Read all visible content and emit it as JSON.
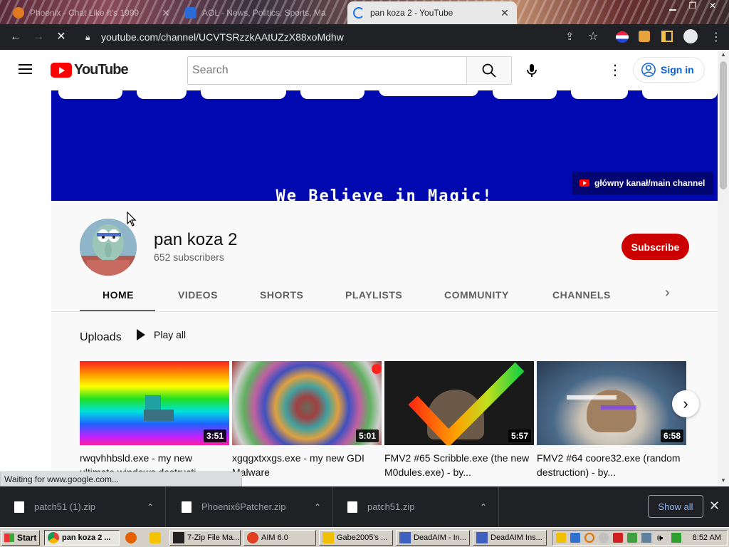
{
  "browser": {
    "tabs": [
      {
        "title": "Phoenix - Chat Like It's 1999"
      },
      {
        "title": "AOL - News, Politics, Sports, Ma"
      },
      {
        "title": "pan koza 2 - YouTube"
      }
    ],
    "url": "youtube.com/channel/UCVTSRzzkAAtUZzX88xoMdhw"
  },
  "youtube": {
    "logo_text": "YouTube",
    "search_placeholder": "Search",
    "sign_in": "Sign in",
    "banner": {
      "text": "We Believe in Magic!",
      "link": "główny kanał/main channel"
    },
    "channel": {
      "name": "pan koza 2",
      "subscribers": "652 subscribers",
      "subscribe_label": "Subscribe",
      "tabs": [
        "HOME",
        "VIDEOS",
        "SHORTS",
        "PLAYLISTS",
        "COMMUNITY",
        "CHANNELS"
      ]
    },
    "uploads": {
      "title": "Uploads",
      "play_all": "Play all",
      "videos": [
        {
          "title": "rwqvhhbsld.exe - my new ultimate windows destructi...",
          "duration": "3:51"
        },
        {
          "title": "xgqgxtxxgs.exe - my new GDI Malware",
          "duration": "5:01"
        },
        {
          "title": "FMV2 #65 Scribble.exe (the new M0dules.exe) - by...",
          "duration": "5:57"
        },
        {
          "title": "FMV2 #64 coore32.exe (random destruction) - by...",
          "duration": "6:58"
        }
      ]
    }
  },
  "status_text": "Waiting for www.google.com...",
  "downloads": {
    "items": [
      {
        "name": "patch51 (1).zip"
      },
      {
        "name": "Phoenix6Patcher.zip"
      },
      {
        "name": "patch51.zip"
      }
    ],
    "show_all": "Show all"
  },
  "taskbar": {
    "start": "Start",
    "items": [
      {
        "label": "pan koza 2 ..."
      },
      {
        "label": "7-Zip File Ma..."
      },
      {
        "label": "AIM 6.0"
      },
      {
        "label": "Gabe2005's ..."
      },
      {
        "label": "DeadAIM - In..."
      },
      {
        "label": "DeadAIM Ins..."
      }
    ],
    "clock": "8:52 AM"
  }
}
